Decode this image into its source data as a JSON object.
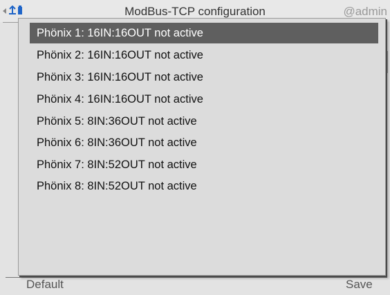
{
  "header": {
    "title": "ModBus-TCP configuration",
    "user": "@admin",
    "nav_icon": "chevron-left-icon",
    "app_icon": "network-device-icon"
  },
  "footer": {
    "left_button": "Default",
    "right_button": "Save"
  },
  "dropdown": {
    "selected_index": 0,
    "options": [
      "Phönix 1: 16IN:16OUT not active",
      "Phönix 2: 16IN:16OUT not active",
      "Phönix 3: 16IN:16OUT not active",
      "Phönix 4: 16IN:16OUT not active",
      "Phönix 5: 8IN:36OUT not active",
      "Phönix 6: 8IN:36OUT not active",
      "Phönix 7: 8IN:52OUT not active",
      "Phönix 8: 8IN:52OUT not active"
    ]
  },
  "colors": {
    "selected_bg": "#5f5f5f",
    "popup_bg": "#dcdcdc",
    "icon_blue": "#1e64c8"
  }
}
